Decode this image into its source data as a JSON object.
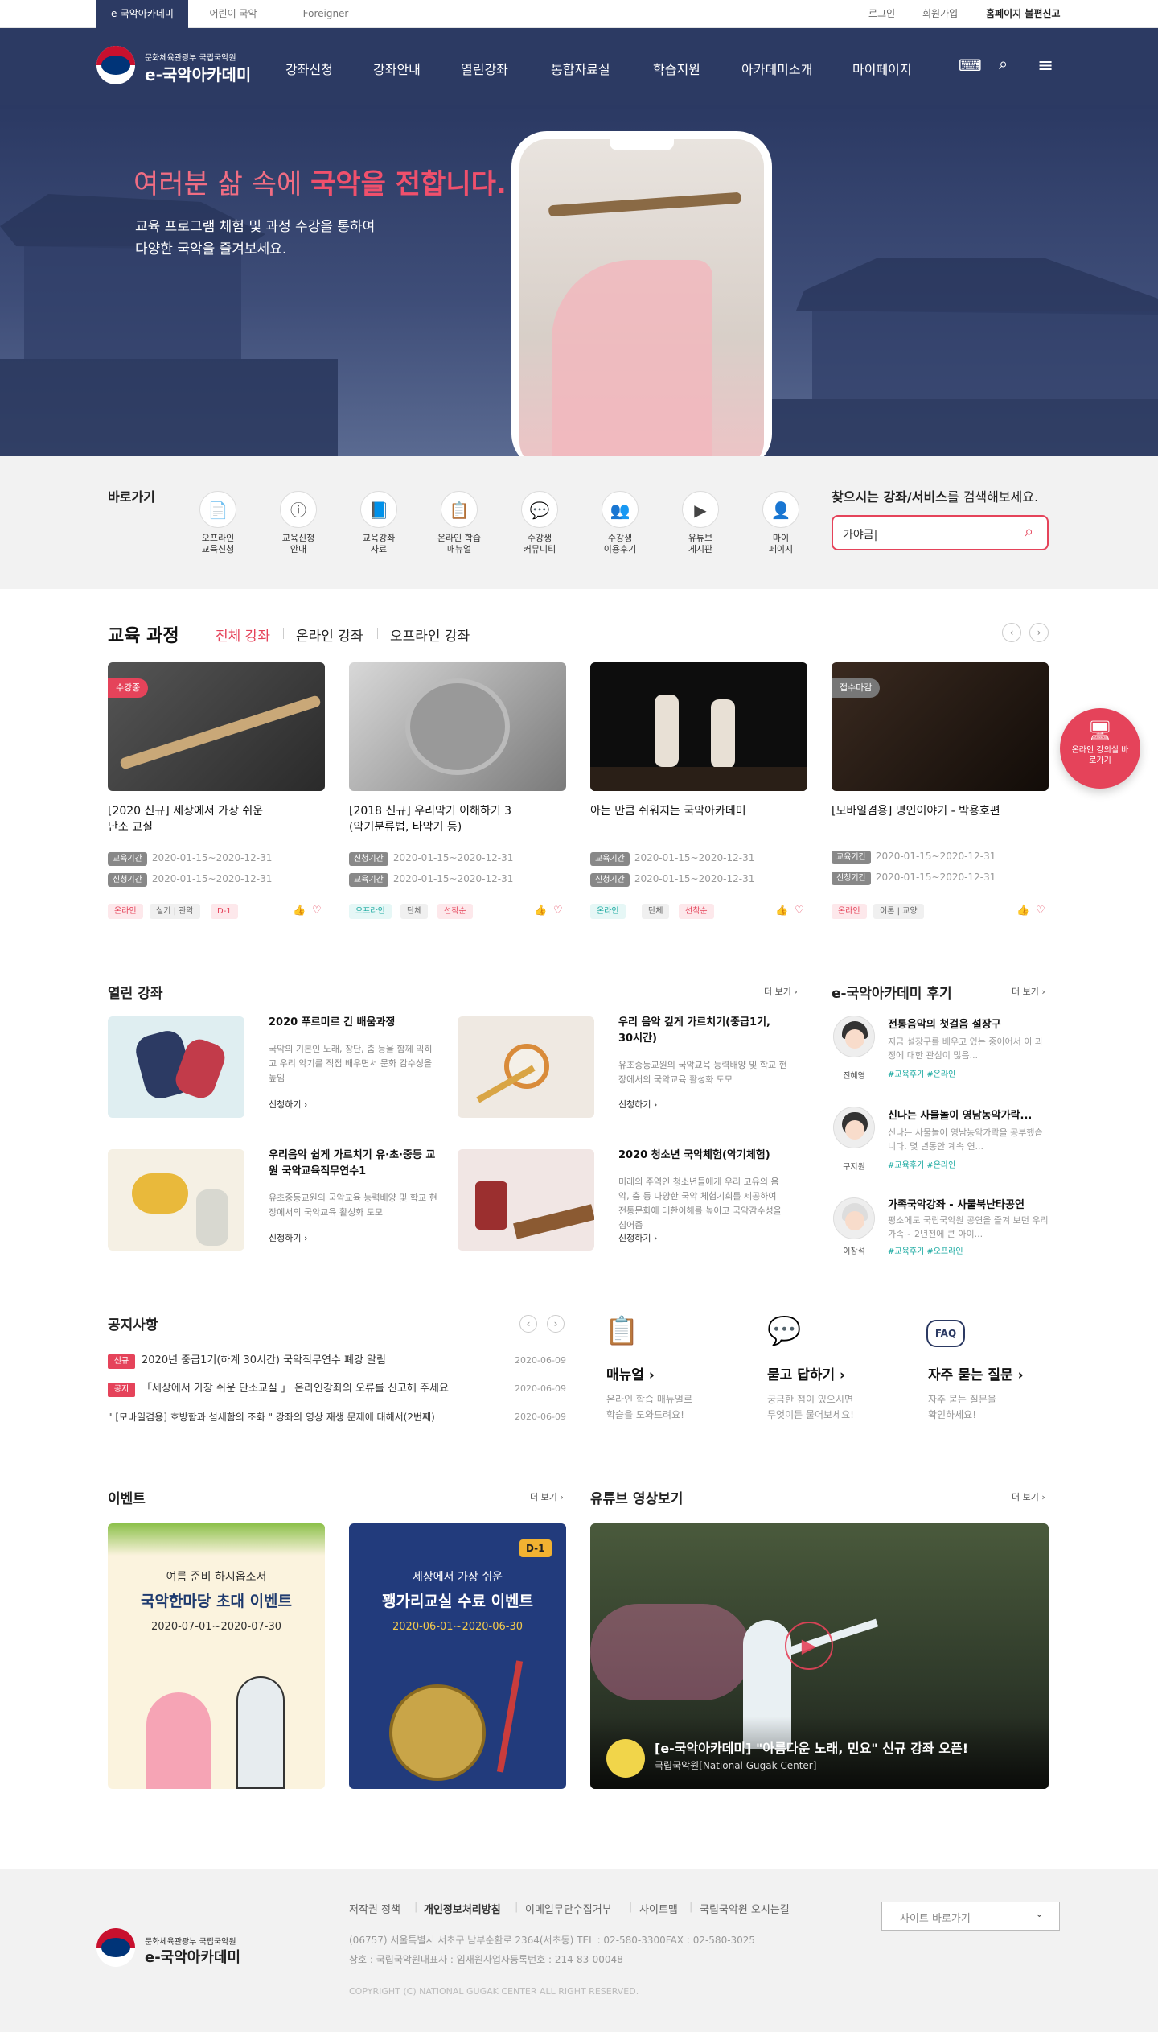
{
  "utility": {
    "tabs": [
      "e-국악아카데미",
      "어린이 국악",
      "Foreigner"
    ],
    "links": [
      "로그인",
      "회원가입",
      "홈페이지 불편신고"
    ]
  },
  "header": {
    "logo_sub": "문화체육관광부 국립국악원",
    "logo_main": "e-국악아카데미",
    "menu": [
      "강좌신청",
      "강좌안내",
      "열린강좌",
      "통합자료실",
      "학습지원",
      "아카데미소개",
      "마이페이지"
    ]
  },
  "hero": {
    "headline_light": "여러분 삶 속에",
    "headline_bold": "국악을 전합니다.",
    "line1": "교육 프로그램 체험 및 과정 수강을 통하여",
    "line2": "다양한 국악을 즐겨보세요."
  },
  "quick": {
    "title": "바로가기",
    "items": [
      {
        "l1": "오프라인",
        "l2": "교육신청",
        "icon": "document-icon"
      },
      {
        "l1": "교육신청",
        "l2": "안내",
        "icon": "info-icon"
      },
      {
        "l1": "교육강좌",
        "l2": "자료",
        "icon": "book-icon"
      },
      {
        "l1": "온라인 학습",
        "l2": "매뉴얼",
        "icon": "manual-icon"
      },
      {
        "l1": "수강생",
        "l2": "커뮤니티",
        "icon": "chat-icon"
      },
      {
        "l1": "수강생",
        "l2": "이용후기",
        "icon": "group-icon"
      },
      {
        "l1": "유튜브",
        "l2": "게시판",
        "icon": "play-icon"
      },
      {
        "l1": "마이",
        "l2": "페이지",
        "icon": "user-icon"
      }
    ],
    "search_title_bold": "찾으시는 강좌/서비스",
    "search_title_rest": "를 검색해보세요.",
    "search_value": "가야금|"
  },
  "courses": {
    "title": "교육 과정",
    "tabs": [
      "전체 강좌",
      "온라인 강좌",
      "오프라인 강좌"
    ],
    "cards": [
      {
        "badge": "수강중",
        "t1": "[2020 신규] 세상에서 가장 쉬운",
        "t2": "단소 교실",
        "k1": "교육기간",
        "d1": "2020-01-15~2020-12-31",
        "k2": "신청기간",
        "d2": "2020-01-15~2020-12-31",
        "chips": [
          "온라인",
          "실기 | 관악",
          "D-1"
        ]
      },
      {
        "badge": "",
        "t1": "[2018 신규] 우리악기 이해하기 3",
        "t2": "(악기분류법, 타악기 등)",
        "k1": "신청기간",
        "d1": "2020-01-15~2020-12-31",
        "k2": "교육기간",
        "d2": "2020-01-15~2020-12-31",
        "chips": [
          "오프라인",
          "단체",
          "선착순"
        ]
      },
      {
        "badge": "",
        "t1": "아는 만큼 쉬워지는 국악아카데미",
        "t2": "",
        "k1": "교육기간",
        "d1": "2020-01-15~2020-12-31",
        "k2": "신청기간",
        "d2": "2020-01-15~2020-12-31",
        "chips": [
          "온라인",
          "단체",
          "선착순"
        ]
      },
      {
        "badge": "접수마감",
        "t1": "[모바일겸용] 명인이야기 - 박용호편",
        "t2": "",
        "k1": "교육기간",
        "d1": "2020-01-15~2020-12-31",
        "k2": "신청기간",
        "d2": "2020-01-15~2020-12-31",
        "chips": [
          "온라인",
          "이론 | 교양"
        ]
      }
    ],
    "floating": "온라인 강의실 바로가기"
  },
  "open": {
    "title": "열린 강좌",
    "more": "더 보기",
    "items": [
      {
        "title": "2020 푸르미르 긴 배움과정",
        "desc": "국악의 기본인 노래, 장단, 춤 등을 함께 익히고 우리 악기를 직접 배우면서 문화 감수성을 높임",
        "link": "신청하기"
      },
      {
        "title": "우리 음악 깊게 가르치기(중급1기, 30시간)",
        "desc": "유초중등교원의 국악교육 능력배양 및 학교 현장에서의 국악교육 활성화 도모",
        "link": "신청하기"
      },
      {
        "title": "우리음악 쉽게 가르치기 유·초·중등 교원 국악교육직무연수1",
        "desc": "유초중등교원의 국악교육 능력배양 및 학교 현장에서의 국악교육 활성화 도모",
        "link": "신청하기"
      },
      {
        "title": "2020 청소년 국악체험(악기체험)",
        "desc": "미래의 주역인 청소년들에게 우리 고유의 음악, 춤 등 다양한 국악 체험기회를 제공하여 전통문화에 대한이해를 높이고 국악감수성을 심어줌",
        "link": "신청하기"
      }
    ]
  },
  "review": {
    "title": "e-국악아카데미 후기",
    "more": "더 보기",
    "items": [
      {
        "name": "진혜영",
        "title": "전통음악의 첫걸음 설장구",
        "desc": "지금 설장구를 배우고 있는 중이어서 이 과정에 대한 관심이 많음...",
        "tags": "#교육후기 #온라인"
      },
      {
        "name": "구지원",
        "title": "신나는 사물놀이 영남농악가락...",
        "desc": "신나는 사물놀이 영남농악가락을 공부했습니다. 몇 년동안 계속 연...",
        "tags": "#교육후기 #온라인"
      },
      {
        "name": "이창석",
        "title": "가족국악강좌 - 사물북난타공연",
        "desc": "평소에도 국립국악원 공연을 즐겨 보던 우리 가족~ 2년전에 큰 아이...",
        "tags": "#교육후기 #오프라인"
      }
    ]
  },
  "notice": {
    "title": "공지사항",
    "items": [
      {
        "badge": "신규",
        "text": "2020년 중급1기(하계 30시간) 국악직무연수 폐강 알림",
        "date": "2020-06-09"
      },
      {
        "badge": "공지",
        "text": "「세상에서 가장 쉬운 단소교실 」 온라인강좌의 오류를 신고해 주세요",
        "date": "2020-06-09"
      },
      {
        "badge": "",
        "text": "\" [모바일겸용] 호방함과 섬세함의 조화 \" 강좌의 영상 재생 문제에 대해서(2번째)",
        "date": "2020-06-09"
      }
    ]
  },
  "services": [
    {
      "title": "매뉴얼",
      "d1": "온라인 학습 매뉴얼로",
      "d2": "학습을 도와드려요!"
    },
    {
      "title": "묻고 답하기",
      "d1": "궁금한 점이 있으시면",
      "d2": "무엇이든 물어보세요!"
    },
    {
      "title": "자주 묻는 질문",
      "d1": "자주 묻는 질문을",
      "d2": "확인하세요!"
    }
  ],
  "events": {
    "title": "이벤트",
    "more": "더 보기",
    "items": [
      {
        "sub": "여름 준비 하시옵소서",
        "title": "국악한마당 초대 이벤트",
        "date": "2020-07-01~2020-07-30",
        "badge": ""
      },
      {
        "sub": "세상에서 가장 쉬운",
        "title": "꽹가리교실 수료 이벤트",
        "date": "2020-06-01~2020-06-30",
        "badge": "D-1"
      }
    ]
  },
  "youtube": {
    "title": "유튜브 영상보기",
    "more": "더 보기",
    "video_title": "[e-국악아카데미] \"아름다운 노래, 민요\" 신규 강좌 오픈!",
    "channel": "국립국악원[National Gugak Center]"
  },
  "footer": {
    "links": [
      "저작권 정책",
      "개인정보처리방침",
      "이메일무단수집거부",
      "사이트맵",
      "국립국악원 오시는길"
    ],
    "addr1": "(06757) 서울특별시 서초구 남부순환로 2364(서초동) TEL : 02-580-3300FAX : 02-580-3025",
    "addr2": "상호 : 국립국악원대표자 : 임재원사업자등록번호 : 214-83-00048",
    "copy": "COPYRIGHT (C) NATIONAL GUGAK CENTER ALL RIGHT RESERVED.",
    "select": "사이트 바로가기",
    "logo_sub": "문화체육관광부 국립국악원",
    "logo_main": "e-국악아카데미"
  },
  "colors": {
    "navy": "#2c3a63",
    "accent": "#e5435a",
    "teal": "#19a9a0"
  }
}
